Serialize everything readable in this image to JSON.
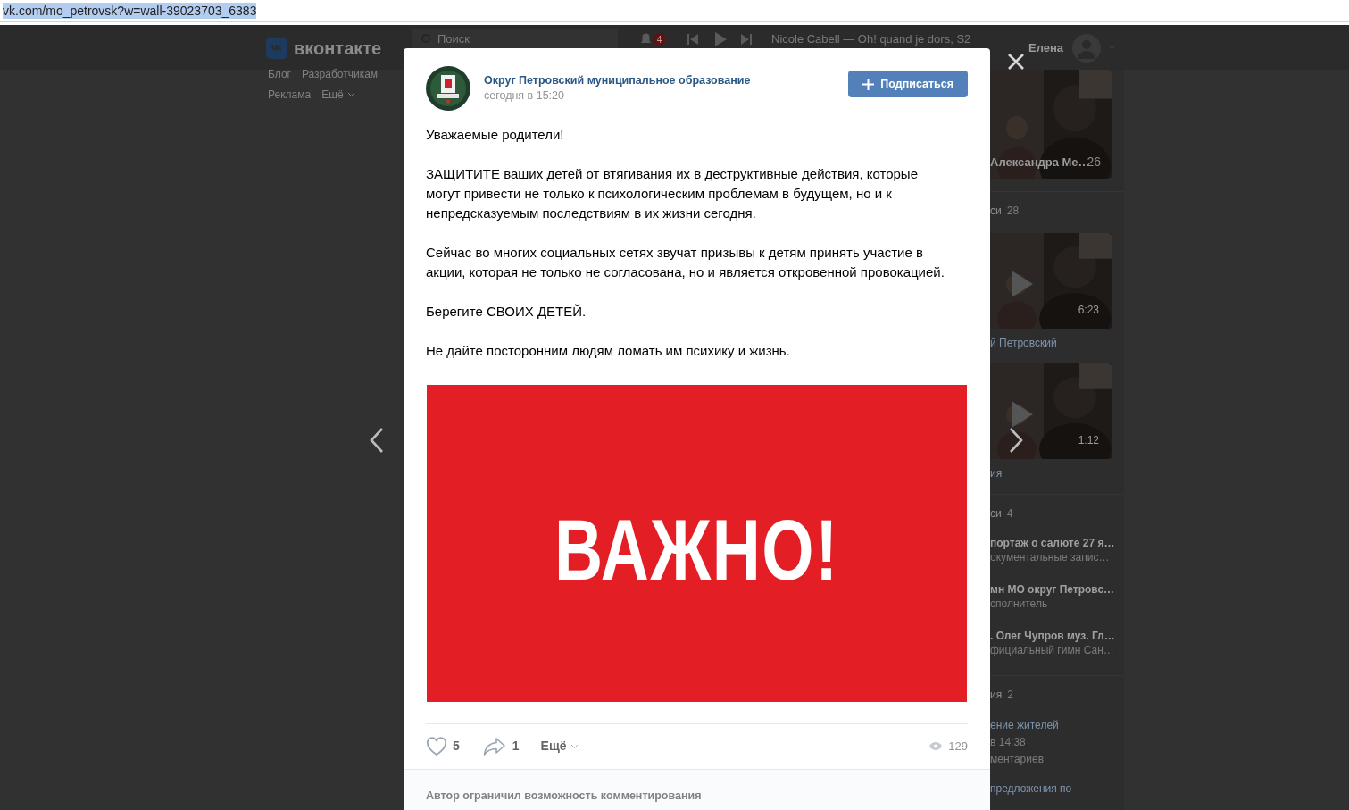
{
  "address_bar": {
    "url": "vk.com/mo_petrovsk?w=wall-39023703_6383"
  },
  "header": {
    "logo": "вконтакте",
    "search_placeholder": "Поиск",
    "notifications": "4",
    "track": "Nicole Cabell — Oh! quand je dors, S2",
    "user": "Елена"
  },
  "left_links": [
    [
      "Блог",
      "Разработчикам"
    ],
    [
      "Реклама",
      "Ещё"
    ]
  ],
  "right_column": [
    {
      "caption": "Александра Ме…",
      "count": "26"
    },
    {
      "kind": "heading",
      "title": "си",
      "count": "28"
    },
    {
      "kind": "video",
      "duration": "6:23",
      "caption": "й Петровский"
    },
    {
      "kind": "video",
      "duration": "1:12",
      "caption": "ия"
    },
    {
      "kind": "heading",
      "title": "си",
      "count": "4"
    },
    {
      "kind": "track",
      "title": "портаж о салюте 27 я…",
      "subtitle": "окументальные запис…"
    },
    {
      "kind": "track",
      "title": "мн МО округ Петровс…",
      "subtitle": "сполнитель"
    },
    {
      "kind": "track",
      "title": ". Олег Чупров муз. Гл…",
      "subtitle": "фициальный гимн Сан…"
    },
    {
      "kind": "heading",
      "title": "ия",
      "count": "2"
    },
    {
      "kind": "topic",
      "lines": [
        "ение жителей",
        "в 14:38",
        "ментариев"
      ]
    },
    {
      "kind": "topic",
      "lines": [
        "предложения по"
      ]
    }
  ],
  "post": {
    "author": "Округ Петровский муниципальное образование",
    "time": "сегодня в 15:20",
    "subscribe": "Подписаться",
    "paragraphs": [
      "Уважаемые родители!",
      "ЗАЩИТИТЕ ваших детей от втягивания их в деструктивные действия, которые могут привести не только к психологическим проблемам в будущем, но и к непредсказуемым последствиям в их жизни сегодня.",
      "Сейчас во многих социальных сетях звучат призывы к детям принять участие в акции, которая не только не согласована, но и является откровенной провокацией.",
      "Берегите СВОИХ ДЕТЕЙ.",
      "Не дайте посторонним людям ломать им психику и жизнь."
    ],
    "image_text": "ВАЖНО!",
    "likes": "5",
    "liked": false,
    "shares": "1",
    "more": "Ещё",
    "views": "129",
    "comments_note": "Автор ограничил возможность комментирования"
  }
}
